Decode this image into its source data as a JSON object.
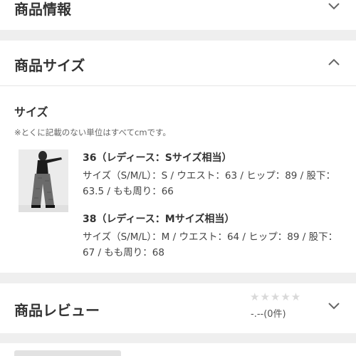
{
  "sections": {
    "info": {
      "title": "商品情報"
    },
    "size": {
      "title": "商品サイズ",
      "label": "サイズ",
      "note": "※とくに記載のない単位はすべてcmです。",
      "entries": [
        {
          "title": "36（レディース：Sサイズ相当）",
          "detail": "サイズ（S/M/L）：S / ウエスト：63 / ヒップ：89 / 股下：63.5 / もも周り：66"
        },
        {
          "title": "38（レディース：Mサイズ相当）",
          "detail": "サイズ（S/M/L）：M / ウエスト：64 / ヒップ：89 / 股下：67 / もも周り：68"
        }
      ]
    },
    "review": {
      "title": "商品レビュー",
      "stars": "★★★★★",
      "rating": "-.--(0件)"
    }
  },
  "icons": {
    "collapsed": "chevron-down-icon",
    "expanded": "chevron-up-icon"
  },
  "colors": {
    "star_inactive": "#d9d9d9",
    "background": "#efefef"
  }
}
